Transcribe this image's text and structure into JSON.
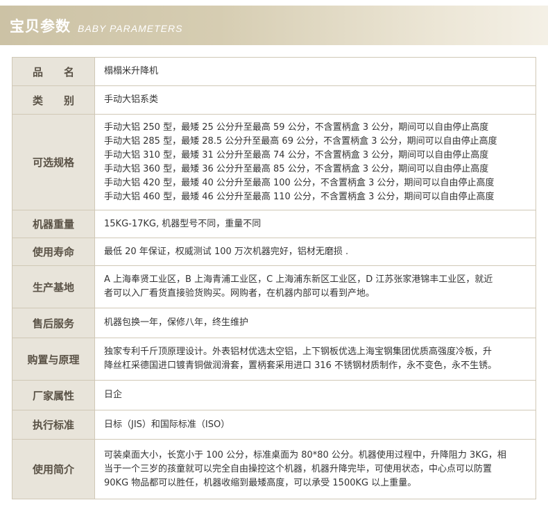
{
  "header": {
    "title": "宝贝参数",
    "subtitle": "BABY PARAMETERS"
  },
  "rows": [
    {
      "label": "品　　名",
      "value": "榻榻米升降机"
    },
    {
      "label": "类　　别",
      "value": "手动大铝系类"
    },
    {
      "label": "可选规格",
      "lines": [
        "手动大铝 250 型，最矮 25 公分升至最高 59 公分，不含置柄盒 3 公分，期间可以自由停止高度",
        "手动大铝 285 型，最矮 28.5 公分升至最高 69 公分，不含置柄盒 3 公分，期间可以自由停止高度",
        "手动大铝 310 型，最矮 31 公分升至最高 74 公分，不含置柄盒 3 公分，期间可以自由停止高度",
        "手动大铝 360 型，最矮 36 公分升至最高 85 公分，不含置柄盒 3 公分，期间可以自由停止高度",
        "手动大铝 420 型，最矮 40 公分升至最高 100 公分，不含置柄盒 3 公分，期间可以自由停止高度",
        "手动大铝 460 型，最矮 46 公分升至最高 110 公分，不含置柄盒 3 公分，期间可以自由停止高度"
      ]
    },
    {
      "label": "机器重量",
      "value": "15KG-17KG, 机器型号不同，重量不同"
    },
    {
      "label": "使用寿命",
      "value": "最低 20 年保证，权威测试 100 万次机器完好，铝材无磨损 ."
    },
    {
      "label": "生产基地",
      "lines": [
        "A 上海奉贤工业区，B 上海青浦工业区，C 上海浦东新区工业区，D 江苏张家港锦丰工业区，就近",
        "者可以入厂看货直接验货购买。网购者，在机器内部可以看到产地。"
      ]
    },
    {
      "label": "售后服务",
      "value": "机器包换一年，保修八年，终生维护"
    },
    {
      "label": "购置与原理",
      "lines": [
        "独家专利千斤顶原理设计。外表铝材优选太空铝，上下钢板优选上海宝钢集团优质高强度冷板，升",
        "降丝杠采德国进口镀青铜做润滑套，置柄套采用进口 316 不锈钢材质制作，永不变色，永不生锈。"
      ]
    },
    {
      "label": "厂家属性",
      "value": "日企"
    },
    {
      "label": "执行标准",
      "value": "日标（JIS）和国际标准（ISO）"
    },
    {
      "label": "使用简介",
      "lines": [
        "可装桌面大小，长宽小于 100 公分，标准桌面为 80*80 公分。机器使用过程中，升降阻力 3KG，相",
        "当于一个三岁的孩童就可以完全自由操控这个机器，机器升降完毕，可使用状态，中心点可以防置",
        "90KG 物品都可以胜任，机器收缩到最矮高度，可以承受 1500KG 以上重量。"
      ]
    }
  ]
}
